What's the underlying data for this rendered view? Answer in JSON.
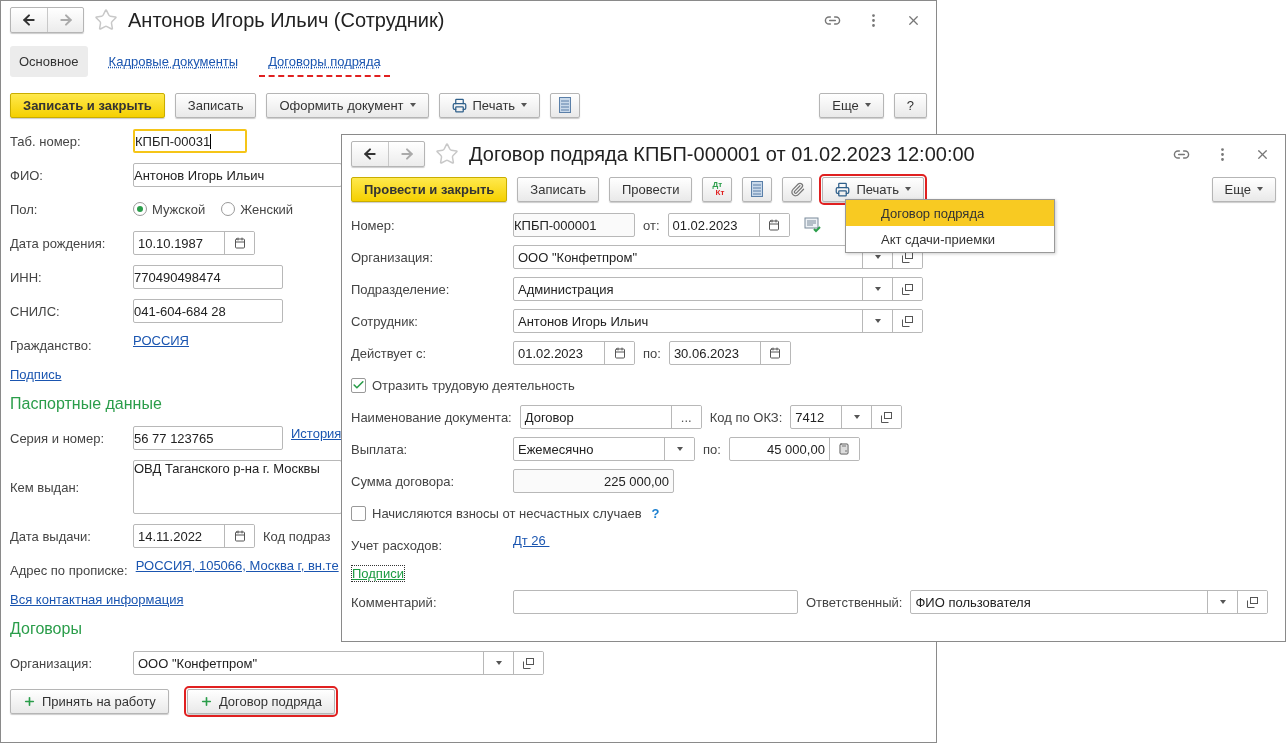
{
  "employee_window": {
    "title": "Антонов Игорь Ильич (Сотрудник)",
    "tabs": [
      {
        "label": "Основное",
        "selected": true,
        "highlighted": false
      },
      {
        "label": "Кадровые документы",
        "selected": false,
        "highlighted": false
      },
      {
        "label": "Договоры подряда",
        "selected": false,
        "highlighted": true
      }
    ],
    "toolbar": [
      {
        "kind": "primary",
        "label": "Записать и закрыть"
      },
      {
        "kind": "button",
        "label": "Записать"
      },
      {
        "kind": "menu",
        "label": "Оформить документ"
      },
      {
        "kind": "print",
        "label": "Печать",
        "highlighted": false
      },
      {
        "kind": "list_icon"
      }
    ],
    "toolbar_right": [
      {
        "kind": "menu",
        "label": "Еще"
      },
      {
        "kind": "button",
        "label": "?"
      }
    ],
    "rows": [
      {
        "kind": "field",
        "label": "Таб. номер:",
        "parts": [
          {
            "kind": "focused_input",
            "value": "КПБП-00031"
          }
        ]
      },
      {
        "kind": "field",
        "label": "ФИО:",
        "parts": [
          {
            "kind": "wide_input",
            "value": "Антонов Игорь Ильич"
          }
        ]
      },
      {
        "kind": "field",
        "label": "Пол:",
        "parts": [
          {
            "kind": "radio",
            "options": [
              {
                "label": "Мужской",
                "selected": true
              },
              {
                "label": "Женский",
                "selected": false
              }
            ]
          }
        ]
      },
      {
        "kind": "field",
        "label": "Дата рождения:",
        "parts": [
          {
            "kind": "date",
            "value": "10.10.1987"
          }
        ]
      },
      {
        "kind": "field",
        "label": "ИНН:",
        "parts": [
          {
            "kind": "input",
            "value": "770490498474"
          }
        ]
      },
      {
        "kind": "field",
        "label": "СНИЛС:",
        "parts": [
          {
            "kind": "input",
            "value": "041-604-684 28"
          }
        ]
      },
      {
        "kind": "field",
        "label": "Гражданство:",
        "parts": [
          {
            "kind": "link",
            "text": "РОССИЯ"
          }
        ]
      },
      {
        "kind": "link",
        "text": "Подпись"
      },
      {
        "kind": "heading",
        "text": "Паспортные данные"
      },
      {
        "kind": "field",
        "label": "Серия и номер:",
        "parts": [
          {
            "kind": "input",
            "value": "56 77 123765"
          },
          {
            "kind": "link",
            "text": "История"
          }
        ]
      },
      {
        "kind": "field",
        "label": "Кем выдан:",
        "parts": [
          {
            "kind": "textarea",
            "value": "ОВД Таганского р-на г. Москвы"
          }
        ]
      },
      {
        "kind": "field",
        "label": "Дата выдачи:",
        "parts": [
          {
            "kind": "date",
            "value": "14.11.2022"
          },
          {
            "kind": "caption",
            "text": "Код подраз"
          }
        ]
      },
      {
        "kind": "field",
        "label": "Адрес по прописке:",
        "parts": [
          {
            "kind": "link",
            "text": "РОССИЯ, 105066, Москва г, вн.те"
          }
        ]
      },
      {
        "kind": "link",
        "text": "Вся контактная информация"
      },
      {
        "kind": "heading",
        "text": "Договоры"
      },
      {
        "kind": "field",
        "label": "Организация:",
        "parts": [
          {
            "kind": "select",
            "value": "ООО \"Конфетпром\""
          }
        ]
      }
    ],
    "bottom_buttons": [
      {
        "label": "Принять на работу",
        "highlighted": false
      },
      {
        "label": "Договор подряда",
        "highlighted": true
      }
    ]
  },
  "contract_window": {
    "title": "Договор подряда КПБП-000001 от 01.02.2023 12:00:00",
    "toolbar": [
      {
        "kind": "primary",
        "label": "Провести и закрыть"
      },
      {
        "kind": "button",
        "label": "Записать"
      },
      {
        "kind": "button",
        "label": "Провести"
      },
      {
        "kind": "dtkt",
        "top": "Дт",
        "bottom": "Кт"
      },
      {
        "kind": "list_icon"
      },
      {
        "kind": "clip_icon"
      },
      {
        "kind": "print",
        "label": "Печать",
        "highlighted": true
      }
    ],
    "toolbar_right": [
      {
        "kind": "menu",
        "label": "Еще"
      }
    ],
    "rows": [
      {
        "kind": "field",
        "label": "Номер:",
        "parts": [
          {
            "kind": "readonly",
            "value": "КПБП-000001"
          },
          {
            "kind": "caption",
            "text": "от:"
          },
          {
            "kind": "date",
            "value": "01.02.2023"
          },
          {
            "kind": "comment_icon"
          }
        ]
      },
      {
        "kind": "field",
        "label": "Организация:",
        "parts": [
          {
            "kind": "select",
            "value": "ООО \"Конфетпром\""
          }
        ]
      },
      {
        "kind": "field",
        "label": "Подразделение:",
        "parts": [
          {
            "kind": "select",
            "value": "Администрация"
          }
        ]
      },
      {
        "kind": "field",
        "label": "Сотрудник:",
        "parts": [
          {
            "kind": "select",
            "value": "Антонов Игорь Ильич"
          }
        ]
      },
      {
        "kind": "field",
        "label": "Действует с:",
        "parts": [
          {
            "kind": "date",
            "value": "01.02.2023"
          },
          {
            "kind": "caption",
            "text": "по:"
          },
          {
            "kind": "date",
            "value": "30.06.2023"
          }
        ]
      },
      {
        "kind": "checkbox",
        "text": "Отразить трудовую деятельность",
        "checked": true
      },
      {
        "kind": "field",
        "label": "Наименование документа:",
        "parts": [
          {
            "kind": "choice",
            "value": "Договор",
            "button": "..."
          },
          {
            "kind": "caption",
            "text": "Код по ОКЗ:"
          },
          {
            "kind": "short_select",
            "value": "7412"
          }
        ]
      },
      {
        "kind": "field",
        "label": "Выплата:",
        "parts": [
          {
            "kind": "dropdown",
            "value": "Ежемесячно"
          },
          {
            "kind": "caption",
            "text": "по:"
          },
          {
            "kind": "number",
            "value": "45 000,00"
          }
        ]
      },
      {
        "kind": "field",
        "label": "Сумма договора:",
        "parts": [
          {
            "kind": "readonly_number",
            "value": "225 000,00"
          }
        ]
      },
      {
        "kind": "checkbox",
        "text": "Начисляются взносы от несчастных случаев",
        "checked": false,
        "help": "?"
      },
      {
        "kind": "field",
        "label": "Учет расходов:",
        "parts": [
          {
            "kind": "link",
            "text": "Дт 26 "
          }
        ]
      },
      {
        "kind": "focused_link",
        "text": "Подписи"
      },
      {
        "kind": "field",
        "label": "Комментарий:",
        "parts": [
          {
            "kind": "wide_field"
          },
          {
            "kind": "caption",
            "text": "Ответственный:"
          },
          {
            "kind": "select",
            "value": "ФИО пользователя"
          }
        ]
      }
    ]
  },
  "print_menu": {
    "items": [
      {
        "label": "Договор подряда",
        "selected": true
      },
      {
        "label": "Акт сдачи-приемки",
        "selected": false
      }
    ]
  }
}
